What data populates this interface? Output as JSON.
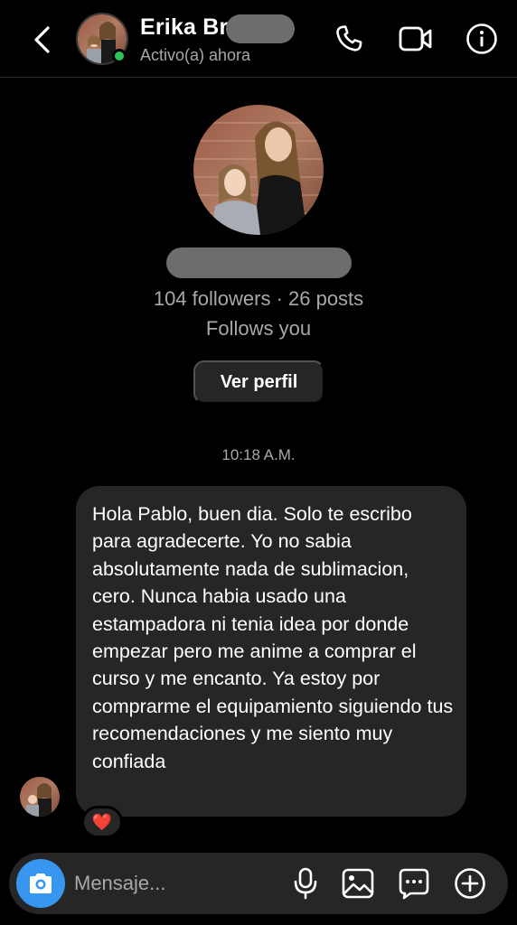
{
  "header": {
    "contact_name": "Erika Bru",
    "status": "Activo(a) ahora",
    "online_color": "#2ec25a",
    "icons": [
      "back-arrow-icon",
      "phone-icon",
      "video-camera-icon",
      "info-icon"
    ]
  },
  "profile": {
    "stats": "104 followers · 26 posts",
    "follows": "Follows you",
    "view_profile_label": "Ver perfil"
  },
  "conversation": {
    "timestamp": "10:18 A.M.",
    "messages": [
      {
        "from": "contact",
        "text": "Hola Pablo, buen dia. Solo te escribo para agradecerte. Yo no sabia absolutamente nada de sublimacion, cero. Nunca habia usado una estampadora ni tenia idea por donde empezar pero me anime a comprar el curso y me encanto. Ya estoy por comprarme el equipamiento siguiendo tus recomendaciones y me siento muy confiada",
        "reaction": "❤️"
      }
    ]
  },
  "composer": {
    "placeholder": "Mensaje...",
    "camera_color": "#3797f0",
    "icons": [
      "camera-icon",
      "microphone-icon",
      "gallery-icon",
      "sticker-icon",
      "plus-icon"
    ]
  }
}
